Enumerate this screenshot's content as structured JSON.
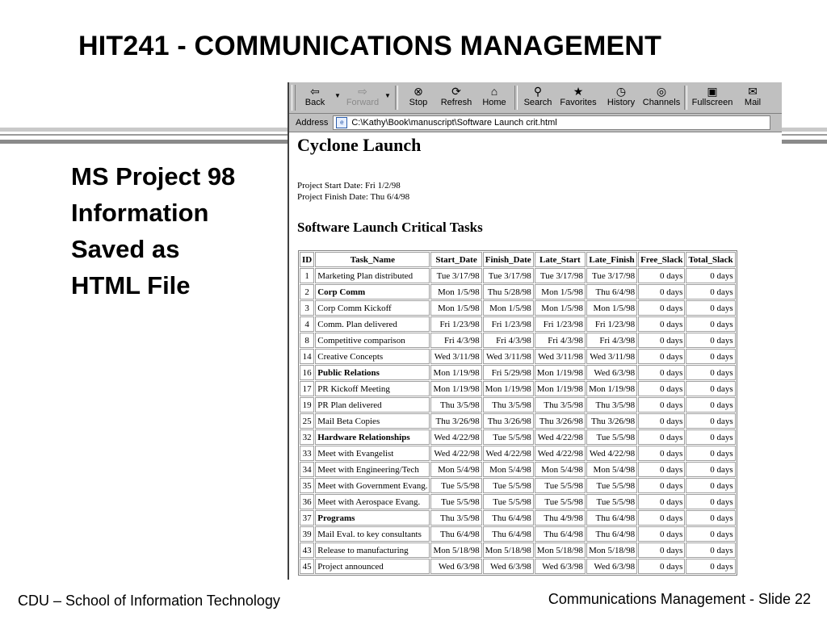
{
  "slide": {
    "title": "HIT241 - COMMUNICATIONS MANAGEMENT",
    "left_lines": [
      "MS Project 98",
      "Information",
      "Saved as",
      "HTML File"
    ],
    "footer_left": "CDU – School of Information Technology",
    "footer_right": "Communications Management - Slide 22"
  },
  "browser": {
    "toolbar": [
      {
        "label": "Back",
        "icon": "back-arrow-icon",
        "glyph": "⇦",
        "disabled": false,
        "dropdown": true
      },
      {
        "label": "Forward",
        "icon": "forward-arrow-icon",
        "glyph": "⇨",
        "disabled": true,
        "dropdown": true
      },
      {
        "label": "Stop",
        "icon": "stop-icon",
        "glyph": "⊗",
        "disabled": false
      },
      {
        "label": "Refresh",
        "icon": "refresh-icon",
        "glyph": "⟳",
        "disabled": false
      },
      {
        "label": "Home",
        "icon": "home-icon",
        "glyph": "⌂",
        "disabled": false
      },
      {
        "label": "Search",
        "icon": "search-icon",
        "glyph": "⚲",
        "disabled": false
      },
      {
        "label": "Favorites",
        "icon": "favorites-icon",
        "glyph": "★",
        "disabled": false
      },
      {
        "label": "History",
        "icon": "history-icon",
        "glyph": "◷",
        "disabled": false
      },
      {
        "label": "Channels",
        "icon": "channels-icon",
        "glyph": "◎",
        "disabled": false
      },
      {
        "label": "Fullscreen",
        "icon": "fullscreen-icon",
        "glyph": "▣",
        "disabled": false
      },
      {
        "label": "Mail",
        "icon": "mail-icon",
        "glyph": "✉",
        "disabled": false
      }
    ],
    "address_label": "Address",
    "address_value": "C:\\Kathy\\Book\\manuscript\\Software Launch crit.html"
  },
  "page": {
    "heading": "Cyclone Launch",
    "start_date": "Project Start Date: Fri 1/2/98",
    "finish_date": "Project Finish Date: Thu 6/4/98",
    "subheading": "Software Launch Critical Tasks",
    "columns": [
      "ID",
      "Task_Name",
      "Start_Date",
      "Finish_Date",
      "Late_Start",
      "Late_Finish",
      "Free_Slack",
      "Total_Slack"
    ],
    "rows": [
      {
        "id": "1",
        "name": "Marketing Plan distributed",
        "bold": false,
        "start": "Tue 3/17/98",
        "finish": "Tue 3/17/98",
        "late_start": "Tue 3/17/98",
        "late_finish": "Tue 3/17/98",
        "free_slack": "0 days",
        "total_slack": "0 days"
      },
      {
        "id": "2",
        "name": "Corp Comm",
        "bold": true,
        "start": "Mon 1/5/98",
        "finish": "Thu 5/28/98",
        "late_start": "Mon 1/5/98",
        "late_finish": "Thu 6/4/98",
        "free_slack": "0 days",
        "total_slack": "0 days"
      },
      {
        "id": "3",
        "name": "Corp Comm Kickoff",
        "bold": false,
        "start": "Mon 1/5/98",
        "finish": "Mon 1/5/98",
        "late_start": "Mon 1/5/98",
        "late_finish": "Mon 1/5/98",
        "free_slack": "0 days",
        "total_slack": "0 days"
      },
      {
        "id": "4",
        "name": "Comm. Plan delivered",
        "bold": false,
        "start": "Fri 1/23/98",
        "finish": "Fri 1/23/98",
        "late_start": "Fri 1/23/98",
        "late_finish": "Fri 1/23/98",
        "free_slack": "0 days",
        "total_slack": "0 days"
      },
      {
        "id": "8",
        "name": "Competitive comparison",
        "bold": false,
        "start": "Fri 4/3/98",
        "finish": "Fri 4/3/98",
        "late_start": "Fri 4/3/98",
        "late_finish": "Fri 4/3/98",
        "free_slack": "0 days",
        "total_slack": "0 days"
      },
      {
        "id": "14",
        "name": "Creative Concepts",
        "bold": false,
        "start": "Wed 3/11/98",
        "finish": "Wed 3/11/98",
        "late_start": "Wed 3/11/98",
        "late_finish": "Wed 3/11/98",
        "free_slack": "0 days",
        "total_slack": "0 days"
      },
      {
        "id": "16",
        "name": "Public Relations",
        "bold": true,
        "start": "Mon 1/19/98",
        "finish": "Fri 5/29/98",
        "late_start": "Mon 1/19/98",
        "late_finish": "Wed 6/3/98",
        "free_slack": "0 days",
        "total_slack": "0 days"
      },
      {
        "id": "17",
        "name": "PR Kickoff Meeting",
        "bold": false,
        "start": "Mon 1/19/98",
        "finish": "Mon 1/19/98",
        "late_start": "Mon 1/19/98",
        "late_finish": "Mon 1/19/98",
        "free_slack": "0 days",
        "total_slack": "0 days"
      },
      {
        "id": "19",
        "name": "PR Plan delivered",
        "bold": false,
        "start": "Thu 3/5/98",
        "finish": "Thu 3/5/98",
        "late_start": "Thu 3/5/98",
        "late_finish": "Thu 3/5/98",
        "free_slack": "0 days",
        "total_slack": "0 days"
      },
      {
        "id": "25",
        "name": "Mail Beta Copies",
        "bold": false,
        "start": "Thu 3/26/98",
        "finish": "Thu 3/26/98",
        "late_start": "Thu 3/26/98",
        "late_finish": "Thu 3/26/98",
        "free_slack": "0 days",
        "total_slack": "0 days"
      },
      {
        "id": "32",
        "name": "Hardware Relationships",
        "bold": true,
        "start": "Wed 4/22/98",
        "finish": "Tue 5/5/98",
        "late_start": "Wed 4/22/98",
        "late_finish": "Tue 5/5/98",
        "free_slack": "0 days",
        "total_slack": "0 days"
      },
      {
        "id": "33",
        "name": "Meet with Evangelist",
        "bold": false,
        "start": "Wed 4/22/98",
        "finish": "Wed 4/22/98",
        "late_start": "Wed 4/22/98",
        "late_finish": "Wed 4/22/98",
        "free_slack": "0 days",
        "total_slack": "0 days"
      },
      {
        "id": "34",
        "name": "Meet with Engineering/Tech",
        "bold": false,
        "start": "Mon 5/4/98",
        "finish": "Mon 5/4/98",
        "late_start": "Mon 5/4/98",
        "late_finish": "Mon 5/4/98",
        "free_slack": "0 days",
        "total_slack": "0 days"
      },
      {
        "id": "35",
        "name": "Meet with Government Evang.",
        "bold": false,
        "start": "Tue 5/5/98",
        "finish": "Tue 5/5/98",
        "late_start": "Tue 5/5/98",
        "late_finish": "Tue 5/5/98",
        "free_slack": "0 days",
        "total_slack": "0 days"
      },
      {
        "id": "36",
        "name": "Meet with Aerospace Evang.",
        "bold": false,
        "start": "Tue 5/5/98",
        "finish": "Tue 5/5/98",
        "late_start": "Tue 5/5/98",
        "late_finish": "Tue 5/5/98",
        "free_slack": "0 days",
        "total_slack": "0 days"
      },
      {
        "id": "37",
        "name": "Programs",
        "bold": true,
        "start": "Thu 3/5/98",
        "finish": "Thu 6/4/98",
        "late_start": "Thu 4/9/98",
        "late_finish": "Thu 6/4/98",
        "free_slack": "0 days",
        "total_slack": "0 days"
      },
      {
        "id": "39",
        "name": "Mail Eval. to key consultants",
        "bold": false,
        "start": "Thu 6/4/98",
        "finish": "Thu 6/4/98",
        "late_start": "Thu 6/4/98",
        "late_finish": "Thu 6/4/98",
        "free_slack": "0 days",
        "total_slack": "0 days"
      },
      {
        "id": "43",
        "name": "Release to manufacturing",
        "bold": false,
        "start": "Mon 5/18/98",
        "finish": "Mon 5/18/98",
        "late_start": "Mon 5/18/98",
        "late_finish": "Mon 5/18/98",
        "free_slack": "0 days",
        "total_slack": "0 days"
      },
      {
        "id": "45",
        "name": "Project announced",
        "bold": false,
        "start": "Wed 6/3/98",
        "finish": "Wed 6/3/98",
        "late_start": "Wed 6/3/98",
        "late_finish": "Wed 6/3/98",
        "free_slack": "0 days",
        "total_slack": "0 days"
      }
    ]
  }
}
